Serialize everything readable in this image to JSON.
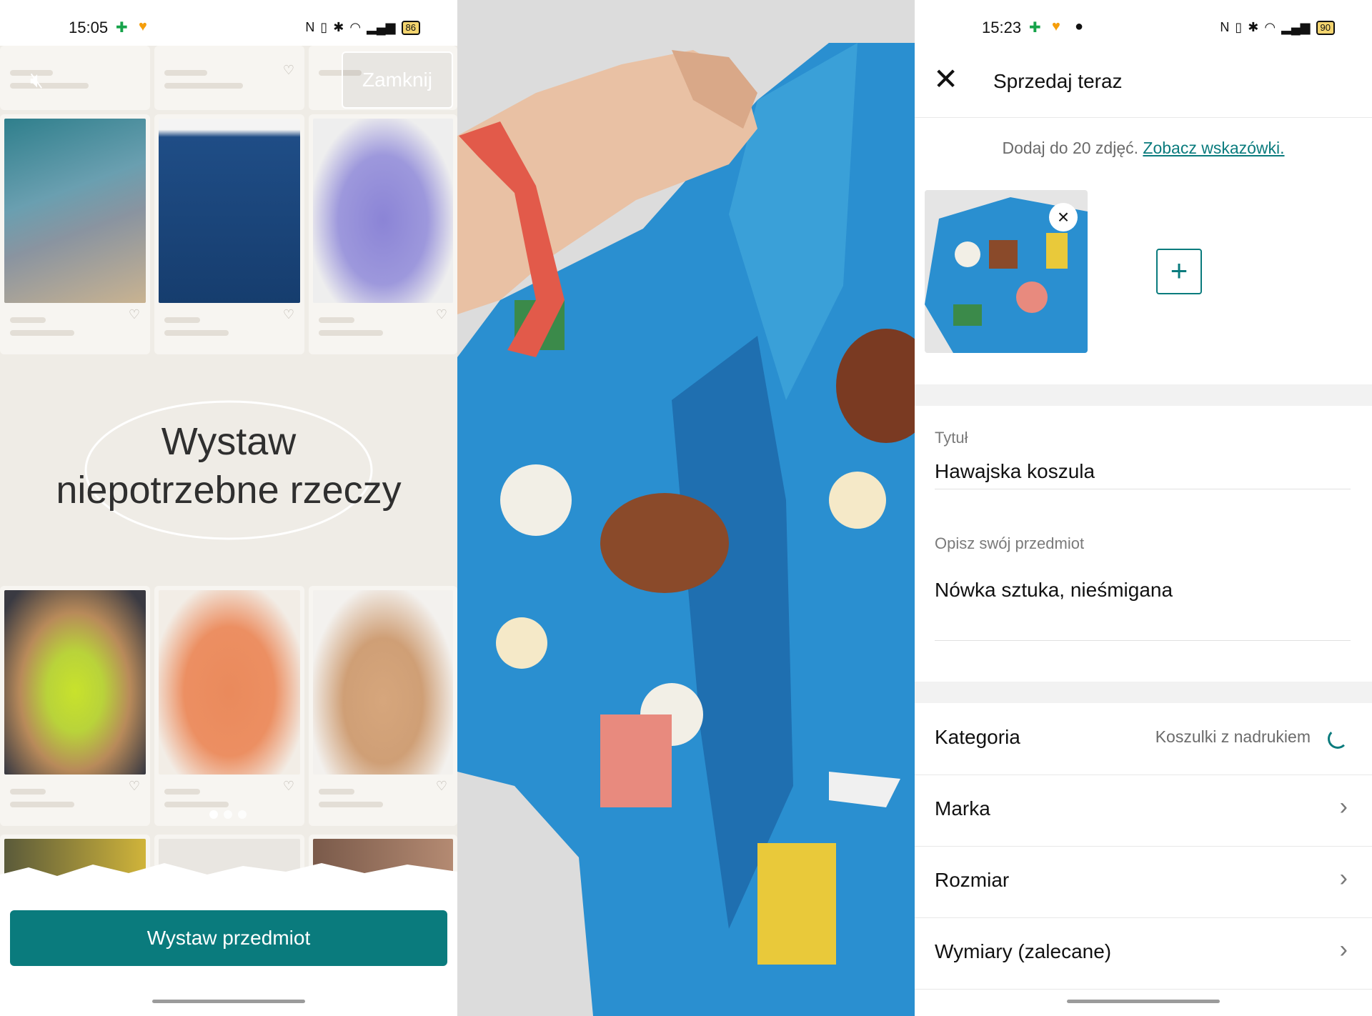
{
  "left": {
    "status": {
      "time": "15:05",
      "battery": "86"
    },
    "close_label": "Zamknij",
    "hero_title_line1": "Wystaw",
    "hero_title_line2": "niepotrzebne rzeczy",
    "cta_label": "Wystaw przedmiot",
    "icons": {
      "mute": "speaker-mute-icon",
      "heart": "heart-outline-icon"
    },
    "carousel": {
      "pages": 3,
      "active_page": 1
    }
  },
  "middle": {
    "photo_subject": "camera-preview"
  },
  "right": {
    "status": {
      "time": "15:23",
      "battery": "90"
    },
    "header_title": "Sprzedaj teraz",
    "hint_text": "Dodaj do 20 zdjęć. ",
    "hint_link": "Zobacz wskazówki.",
    "title_label": "Tytuł",
    "title_value": "Hawajska koszula",
    "description_label": "Opisz swój przedmiot",
    "description_value": "Nówka sztuka, nieśmigana",
    "rows": [
      {
        "label": "Kategoria",
        "value": "Koszulki z nadrukiem"
      },
      {
        "label": "Marka"
      },
      {
        "label": "Rozmiar"
      },
      {
        "label": "Wymiary (zalecane)"
      }
    ]
  },
  "colors": {
    "accent": "#0a7b7d",
    "background": "#efece6"
  }
}
